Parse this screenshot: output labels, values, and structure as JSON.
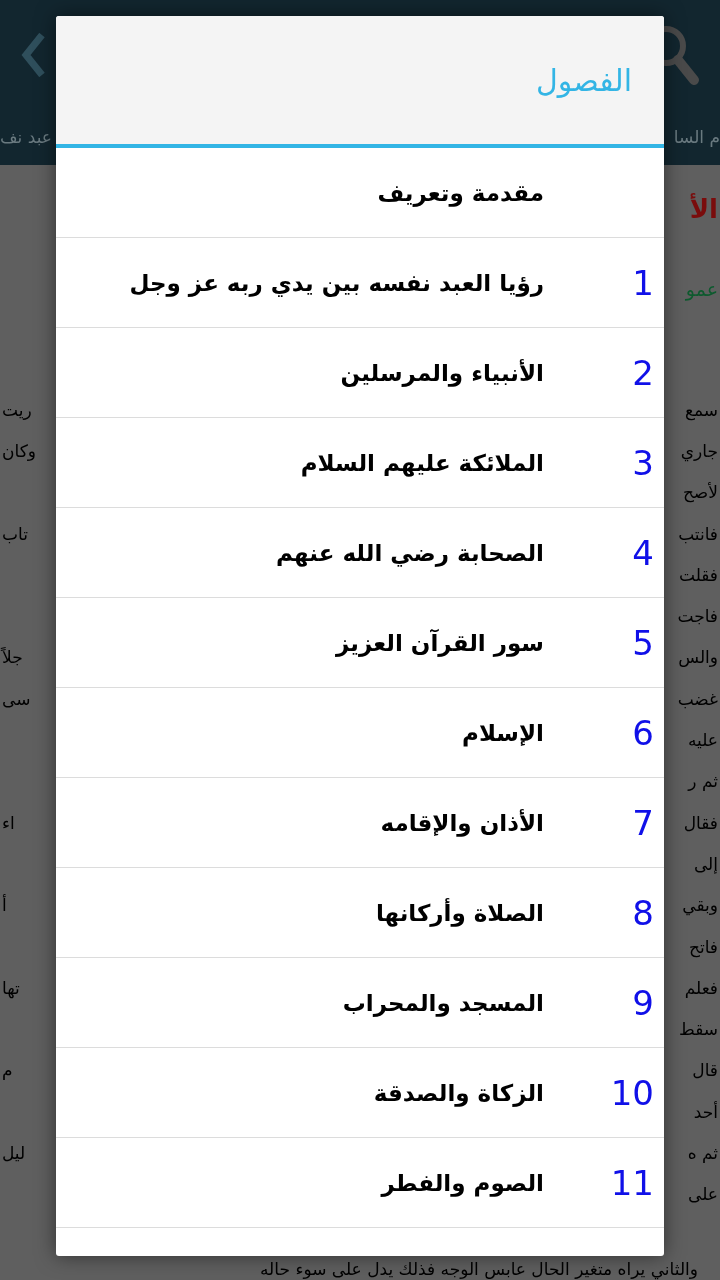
{
  "app_bar": {
    "subtitle_left": "عبد نف",
    "subtitle_right": "م السا"
  },
  "article": {
    "title": "الأ",
    "byline": "عمو",
    "lines": [
      {
        "right": "سمع",
        "left": "ريت"
      },
      {
        "right": "جاري",
        "left": "وكان"
      },
      {
        "right": "لأصح"
      },
      {
        "right": "فانتب",
        "left": "تاب"
      },
      {
        "right": "فقلت"
      },
      {
        "right": "فاجت"
      },
      {
        "right": "والس",
        "left": "جلاً"
      },
      {
        "right": "غضب",
        "left": "سى"
      },
      {
        "right": "عليه"
      },
      {
        "right": "ثم ر"
      },
      {
        "right": "فقال",
        "left": "اء"
      },
      {
        "right": "إلى"
      },
      {
        "right": "وبقي",
        "left": "أ"
      },
      {
        "right": "فاتح"
      },
      {
        "right": "فعلم",
        "left": "تها"
      },
      {
        "right": "سقط"
      },
      {
        "right": "قال",
        "left": "م"
      },
      {
        "right": "أحد"
      },
      {
        "right": "ثم ه",
        "left": "ليل"
      },
      {
        "right": "على"
      }
    ],
    "last_line": "والثاني يراه متغير الحال عابس الوجه فذلك يدل على سوء حاله"
  },
  "dialog": {
    "title": "الفصول",
    "chapters": [
      {
        "title": "مقدمة وتعريف"
      },
      {
        "number": "1",
        "title": "رؤيا العبد نفسه بين يدي ربه عز وجل"
      },
      {
        "number": "2",
        "title": "الأنبياء والمرسلين"
      },
      {
        "number": "3",
        "title": "الملائكة عليهم السلام"
      },
      {
        "number": "4",
        "title": "الصحابة رضي الله عنهم"
      },
      {
        "number": "5",
        "title": "سور القرآن العزيز"
      },
      {
        "number": "6",
        "title": "الإسلام"
      },
      {
        "number": "7",
        "title": "الأذان والإقامه"
      },
      {
        "number": "8",
        "title": "الصلاة وأركانها"
      },
      {
        "number": "9",
        "title": "المسجد والمحراب"
      },
      {
        "number": "10",
        "title": "الزكاة والصدقة"
      },
      {
        "number": "11",
        "title": "الصوم والفطر"
      }
    ]
  }
}
